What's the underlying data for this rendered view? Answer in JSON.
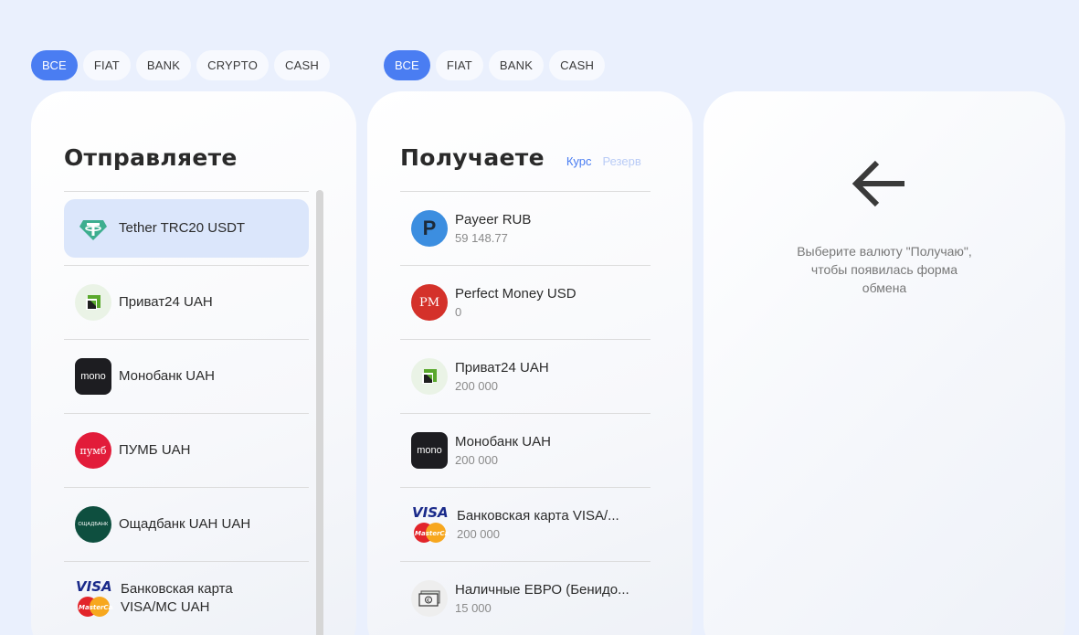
{
  "send_filters": [
    {
      "label": "ВСЕ",
      "active": true
    },
    {
      "label": "FIAT",
      "active": false
    },
    {
      "label": "BANK",
      "active": false
    },
    {
      "label": "CRYPTO",
      "active": false
    },
    {
      "label": "CASH",
      "active": false
    }
  ],
  "recv_filters": [
    {
      "label": "ВСЕ",
      "active": true
    },
    {
      "label": "FIAT",
      "active": false
    },
    {
      "label": "BANK",
      "active": false
    },
    {
      "label": "CASH",
      "active": false
    }
  ],
  "send": {
    "title": "Отправляете",
    "items": [
      {
        "name": "Tether TRC20 USDT",
        "icon": "tether-icon",
        "selected": true
      },
      {
        "name": "Приват24 UAH",
        "icon": "privat24-icon"
      },
      {
        "name": "Монобанк UAH",
        "icon": "monobank-icon",
        "icon_text": "mono"
      },
      {
        "name": "ПУМБ UAH",
        "icon": "pumb-icon",
        "icon_text": "пумб"
      },
      {
        "name": "Ощадбанк UAH UAH",
        "icon": "oschadbank-icon",
        "icon_text": "ОЩАДБАНК"
      },
      {
        "name": "Банковская карта VISA/MC UAH",
        "icon": "visa-mastercard-icon"
      }
    ]
  },
  "recv": {
    "title": "Получаете",
    "sort_rate": "Курс",
    "sort_reserve": "Резерв",
    "items": [
      {
        "name": "Payeer RUB",
        "reserve": "59 148.77",
        "icon": "payeer-icon",
        "icon_text": "P"
      },
      {
        "name": "Perfect Money USD",
        "reserve": "0",
        "icon": "perfect-money-icon",
        "icon_text": "PM"
      },
      {
        "name": "Приват24 UAH",
        "reserve": "200 000",
        "icon": "privat24-icon"
      },
      {
        "name": "Монобанк UAH",
        "reserve": "200 000",
        "icon": "monobank-icon",
        "icon_text": "mono"
      },
      {
        "name": "Банковская карта VISA/...",
        "reserve": "200 000",
        "icon": "visa-mastercard-icon"
      },
      {
        "name": "Наличные ЕВРО (Бенидо...",
        "reserve": "15 000",
        "icon": "cash-euro-icon"
      }
    ]
  },
  "form": {
    "message": "Выберите валюту \"Получаю\", чтобы появилась форма обмена"
  },
  "colors": {
    "accent": "#4a7df2",
    "selected_bg": "#dbe6fb",
    "background": "#eaf0fd"
  }
}
